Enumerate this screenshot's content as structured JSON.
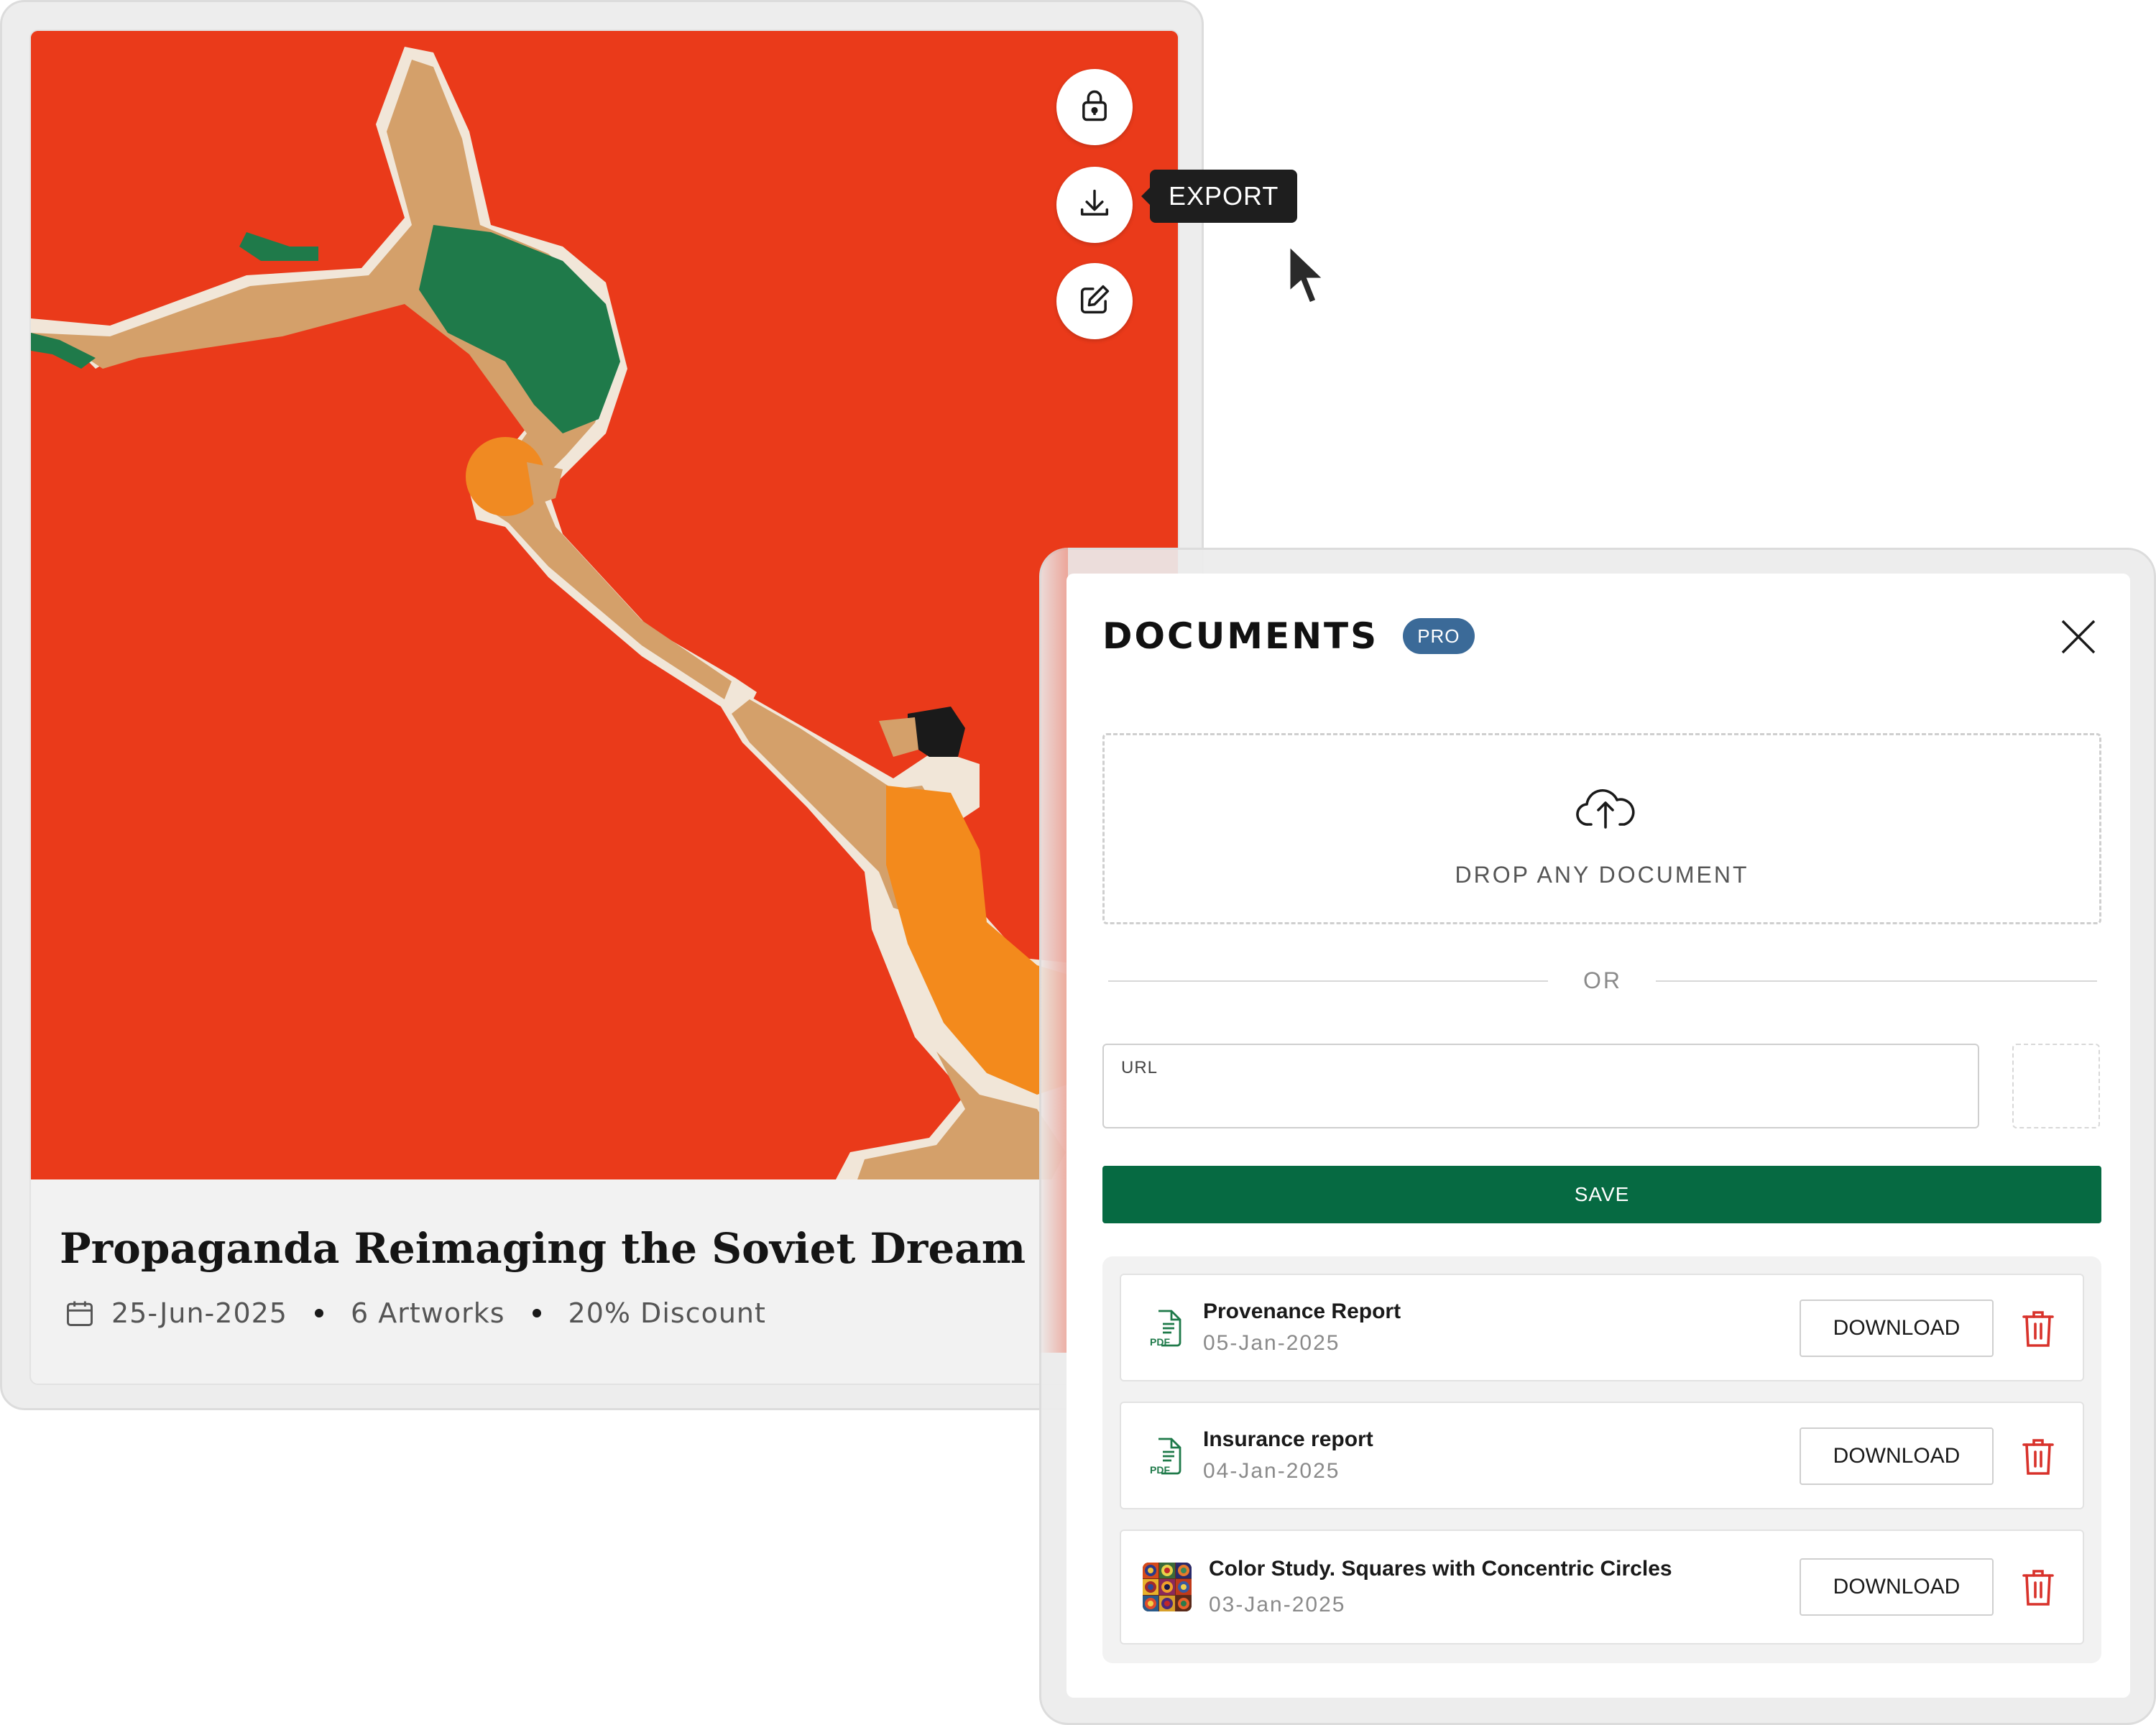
{
  "card": {
    "title": "Propaganda Reimaging the Soviet Dream",
    "date": "25-Jun-2025",
    "artworks": "6 Artworks",
    "discount": "20% Discount",
    "icons": [
      "calendar-icon"
    ]
  },
  "actions": {
    "lock_icon": "lock-icon",
    "export_icon": "download-icon",
    "edit_icon": "edit-icon",
    "tooltip": "EXPORT"
  },
  "panel": {
    "title": "DOCUMENTS",
    "badge": "PRO",
    "dropzone_label": "DROP ANY DOCUMENT",
    "or_text": "OR",
    "url_label": "URL",
    "url_value": "",
    "save_label": "SAVE",
    "documents": [
      {
        "name": "Provenance Report",
        "date": "05-Jan-2025",
        "icon": "pdf-file-icon",
        "action": "DOWNLOAD"
      },
      {
        "name": "Insurance report",
        "date": "04-Jan-2025",
        "icon": "pdf-file-icon",
        "action": "DOWNLOAD"
      },
      {
        "name": "Color Study. Squares with Concentric Circles",
        "date": "03-Jan-2025",
        "icon": "artwork-thumbnail",
        "action": "DOWNLOAD"
      }
    ]
  },
  "colors": {
    "artwork_bg": "#ea3a1a",
    "save_button": "#066a42",
    "pro_badge": "#3b6a98",
    "trash": "#d8322b",
    "pdf_icon": "#1f7a4a"
  }
}
